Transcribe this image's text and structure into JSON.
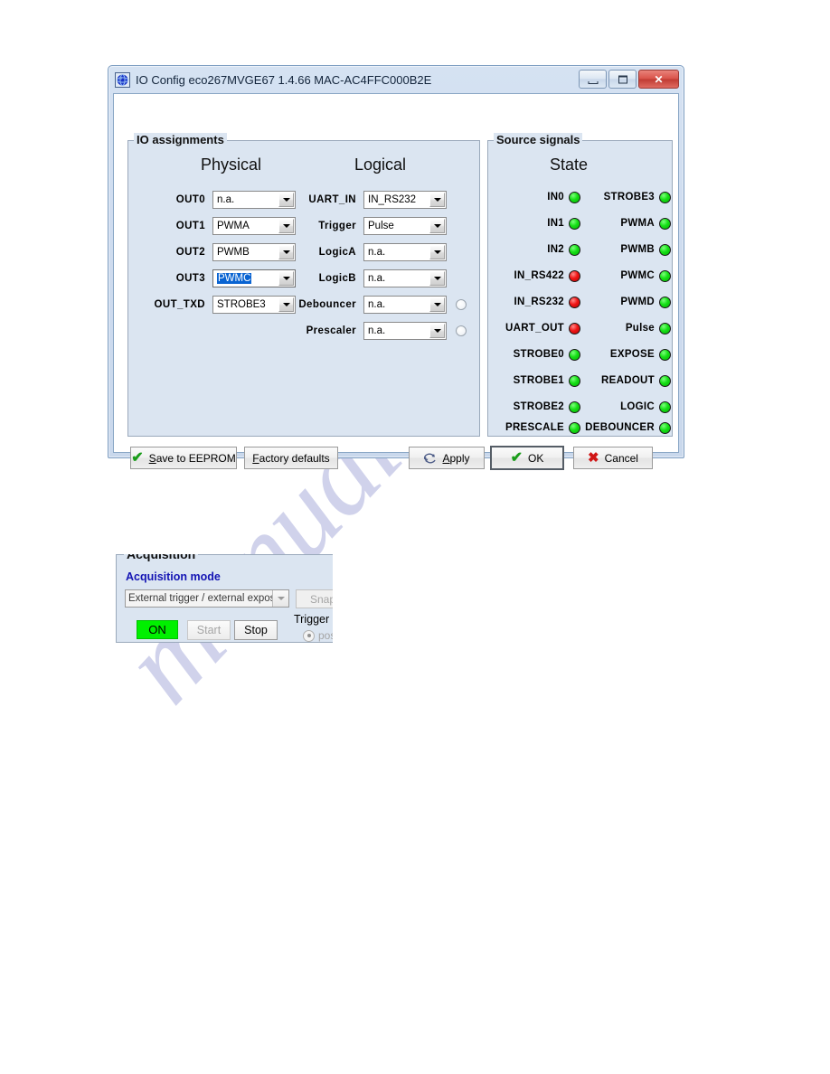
{
  "watermark": {
    "text": "manualshive.com"
  },
  "window": {
    "title": "IO Config eco267MVGE67 1.4.66  MAC-AC4FFC000B2E",
    "icon": "app-globe-icon",
    "caption": {
      "minimize": "minimize-button",
      "maximize": "maximize-button",
      "close": "✕"
    }
  },
  "io_assignments": {
    "group_title": "IO assignments",
    "headers": {
      "physical": "Physical",
      "logical": "Logical"
    },
    "physical_rows": [
      {
        "label": "OUT0",
        "value": "n.a.",
        "focused": false
      },
      {
        "label": "OUT1",
        "value": "PWMA",
        "focused": false
      },
      {
        "label": "OUT2",
        "value": "PWMB",
        "focused": false
      },
      {
        "label": "OUT3",
        "value": "PWMC",
        "focused": true
      },
      {
        "label": "OUT_TXD",
        "value": "STROBE3",
        "focused": false
      }
    ],
    "logical_rows": [
      {
        "label": "UART_IN",
        "value": "IN_RS232",
        "radio": false
      },
      {
        "label": "Trigger",
        "value": "Pulse",
        "radio": false
      },
      {
        "label": "LogicA",
        "value": "n.a.",
        "radio": false
      },
      {
        "label": "LogicB",
        "value": "n.a.",
        "radio": false
      },
      {
        "label": "Debouncer",
        "value": "n.a.",
        "radio": true
      },
      {
        "label": "Prescaler",
        "value": "n.a.",
        "radio": true
      }
    ]
  },
  "source_signals": {
    "group_title": "Source signals",
    "header": "State",
    "left_column": [
      {
        "name": "IN0",
        "state": "green"
      },
      {
        "name": "IN1",
        "state": "green"
      },
      {
        "name": "IN2",
        "state": "green"
      },
      {
        "name": "IN_RS422",
        "state": "red"
      },
      {
        "name": "IN_RS232",
        "state": "red"
      },
      {
        "name": "UART_OUT",
        "state": "red"
      },
      {
        "name": "STROBE0",
        "state": "green"
      },
      {
        "name": "STROBE1",
        "state": "green"
      },
      {
        "name": "STROBE2",
        "state": "green"
      },
      {
        "name": "PRESCALE",
        "state": "green"
      }
    ],
    "right_column": [
      {
        "name": "STROBE3",
        "state": "green"
      },
      {
        "name": "PWMA",
        "state": "green"
      },
      {
        "name": "PWMB",
        "state": "green"
      },
      {
        "name": "PWMC",
        "state": "green"
      },
      {
        "name": "PWMD",
        "state": "green"
      },
      {
        "name": "Pulse",
        "state": "green"
      },
      {
        "name": "EXPOSE",
        "state": "green"
      },
      {
        "name": "READOUT",
        "state": "green"
      },
      {
        "name": "LOGIC",
        "state": "green"
      },
      {
        "name": "DEBOUNCER",
        "state": "green"
      }
    ]
  },
  "buttons": {
    "save_eeprom": {
      "prefix": "",
      "accel": "S",
      "rest": "ave to EEPROM",
      "icon": "green-check-icon"
    },
    "factory_defaults": {
      "prefix": "",
      "accel": "F",
      "rest": "actory defaults",
      "icon": "none"
    },
    "apply": {
      "prefix": "",
      "accel": "A",
      "rest": "pply",
      "icon": "refresh-icon"
    },
    "ok": {
      "label": "OK",
      "icon": "green-check-icon",
      "default": true
    },
    "cancel": {
      "label": "Cancel",
      "icon": "red-x-icon"
    }
  },
  "acquisition": {
    "group_title": "Acquisition",
    "mode_label": "Acquisition mode",
    "mode_value": "External trigger / external expos",
    "snap_label": "Snap",
    "on_label": "ON",
    "start_label": "Start",
    "stop_label": "Stop",
    "trigger_polarity_label": "Trigger polar",
    "polarity_option": "positiv"
  },
  "colors": {
    "led_green": "#16e016",
    "led_red": "#f01515",
    "panel_bg": "#dbe5f1",
    "selection_blue": "#0a64d2",
    "accent_blue_text": "#1414b4",
    "on_green": "#00f000",
    "watermark": "#c8cbe8"
  }
}
